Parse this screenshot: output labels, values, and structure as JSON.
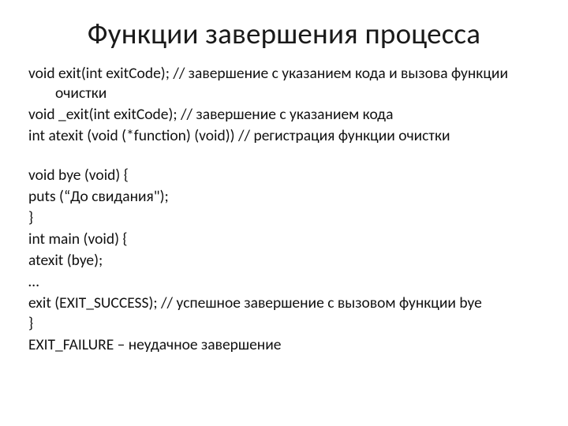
{
  "title": "Функции завершения процесса",
  "lines": {
    "l1": "void exit(int exitCode); // завершение с указанием кода и вызова функции очистки",
    "l2": "void _exit(int exitCode); // завершение с указанием кода",
    "l3": "int  atexit (void (*function) (void)) // регистрация функции очистки",
    "l4": "void bye (void) {",
    "l5": "puts (“До свидания\");",
    "l6": "}",
    "l7": "int main (void) {",
    "l8": "atexit (bye);",
    "l9": "…",
    "l10": "exit (EXIT_SUCCESS); // успешное завершение с вызовом функции bye",
    "l11": "}",
    "l12": "EXIT_FAILURE – неудачное завершение"
  }
}
